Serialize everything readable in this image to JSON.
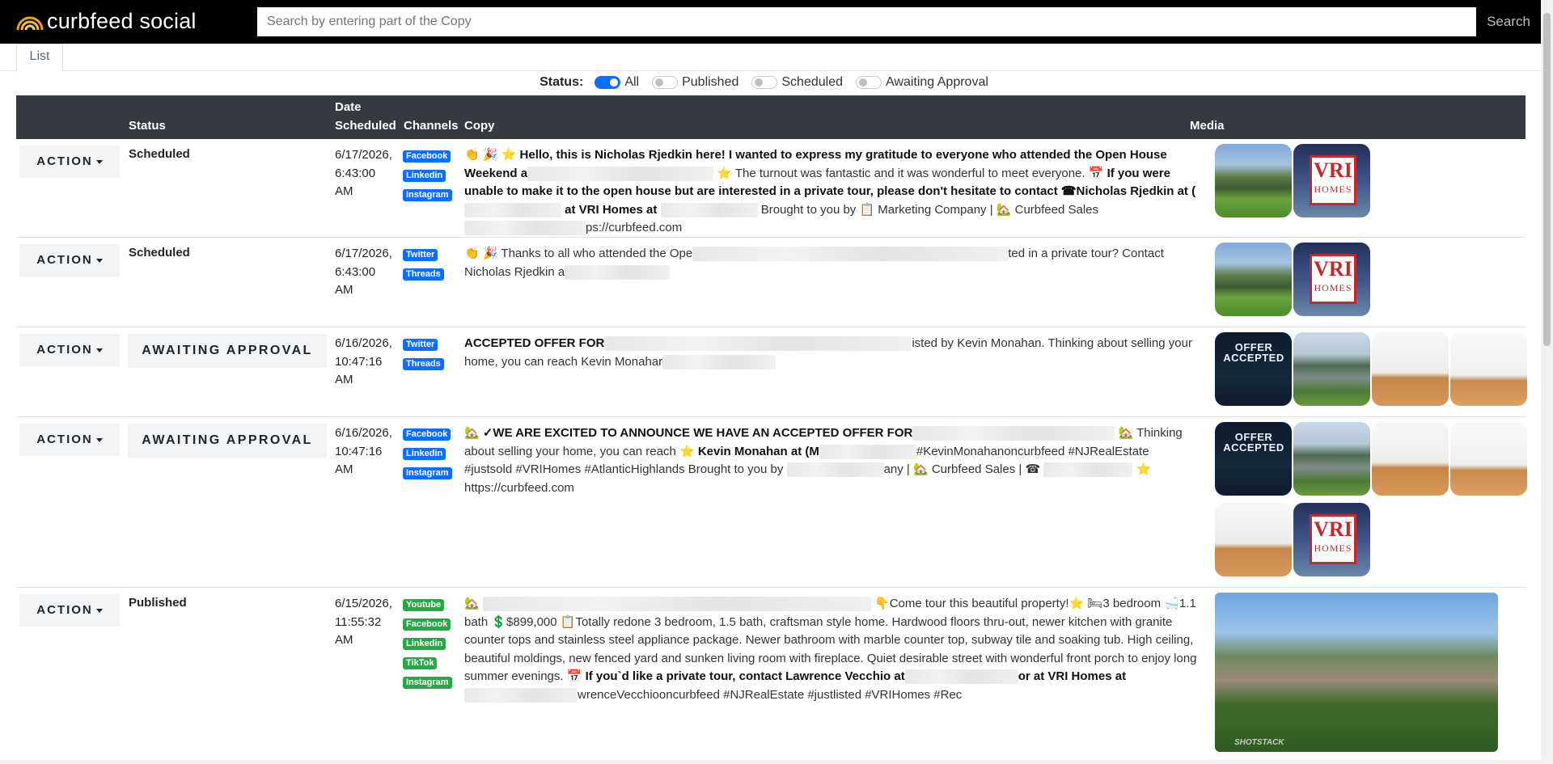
{
  "app": {
    "brand": "curbfeed social"
  },
  "search": {
    "placeholder": "Search by entering part of the Copy",
    "button_label": "Search"
  },
  "tabs": [
    {
      "label": "List"
    }
  ],
  "filters": {
    "label": "Status:",
    "options": [
      {
        "label": "All",
        "on": true
      },
      {
        "label": "Published",
        "on": false
      },
      {
        "label": "Scheduled",
        "on": false
      },
      {
        "label": "Awaiting Approval",
        "on": false
      }
    ]
  },
  "table": {
    "headers": {
      "status": "Status",
      "date_line1": "Date",
      "date_line2": "Scheduled",
      "channels": "Channels",
      "copy": "Copy",
      "media": "Media"
    },
    "action_label": "ACTION",
    "rows": [
      {
        "status": "Scheduled",
        "date": [
          "6/17/2026,",
          "6:43:00",
          "AM"
        ],
        "channels": [
          "Facebook",
          "Linkedin",
          "Instagram"
        ],
        "copy": {
          "c1": "👏 🎉 ⭐",
          "c2": "Hello, this is Nicholas Rjedkin here!",
          "c3": "I wanted to express my gratitude to everyone who attended the Open House Weekend a",
          "c4": "⭐ The turnout was fantastic and it was wonderful to meet everyone. 📅",
          "c5": "If you were unable to make it to the open house but are interested in a private tour, please don't hesitate to contact ☎Nicholas Rjedkin at (",
          "c6": "at VRI Homes at",
          "c7": "Brought to you by 📋 Marketing Company | 🏡 Curbfeed Sales",
          "c8": "ps://curbfeed.com"
        }
      },
      {
        "status": "Scheduled",
        "date": [
          "6/17/2026,",
          "6:43:00",
          "AM"
        ],
        "channels": [
          "Twitter",
          "Threads"
        ],
        "copy": {
          "c1": "👏 🎉 Thanks to all who attended the Ope",
          "c2": "ted in a private tour? Contact Nicholas Rjedkin a"
        }
      },
      {
        "status": "AWAITING APPROVAL",
        "date": [
          "6/16/2026,",
          "10:47:16",
          "AM"
        ],
        "channels": [
          "Twitter",
          "Threads"
        ],
        "copy": {
          "c1": "ACCEPTED OFFER FOR",
          "c2": "isted by Kevin Monahan.   Thinking about selling your home, you can reach Kevin Monahar"
        }
      },
      {
        "status": "AWAITING APPROVAL",
        "date": [
          "6/16/2026,",
          "10:47:16",
          "AM"
        ],
        "channels": [
          "Facebook",
          "Linkedin",
          "Instagram"
        ],
        "copy": {
          "c1": "🏡 ✓WE ARE EXCITED TO ANNOUNCE WE HAVE AN ACCEPTED OFFER FOR",
          "c2": "🏡 Thinking about selling your home, you can reach ⭐",
          "c3": "Kevin Monahan at (M",
          "c4": "#KevinMonahanoncurbfeed #NJRealEstate #justsold #VRIHomes #AtlanticHighlands  Brought to you by",
          "c5": "any | 🏡 Curbfeed Sales | ☎",
          "c6": "⭐ https://curbfeed.com"
        }
      },
      {
        "status": "Published",
        "date": [
          "6/15/2026,",
          "11:55:32",
          "AM"
        ],
        "channels": [
          "Youtube",
          "Facebook",
          "Linkedin",
          "TikTok",
          "Instagram"
        ],
        "copy": {
          "c1": "🏡",
          "c2": "👇Come tour this beautiful property!⭐ 🛏3 bedroom 🛁1.1 bath  💲$899,000 📋Totally redone 3 bedroom, 1.5 bath, craftsman style home. Hardwood floors thru-out, newer kitchen with granite counter tops and stainless steel appliance package. Newer bathroom with marble counter top, subway tile and soaking tub. High ceiling, beautiful moldings, new fenced yard and sunken living room with fireplace. Quiet desirable street with wonderful front porch to enjoy long summer evenings. 📅",
          "c3": "If you`d like a private tour, contact Lawrence Vecchio at",
          "c4": "or at VRI Homes at",
          "c5": "wrenceVecchiooncurbfeed #NJRealEstate #justlisted #VRIHomes #Rec"
        }
      }
    ]
  },
  "media": {
    "vri_text_big": "VRI",
    "vri_text_small": "HOMES",
    "offer_text": "OFFER ACCEPTED",
    "watermark": "SHOTSTACK"
  }
}
